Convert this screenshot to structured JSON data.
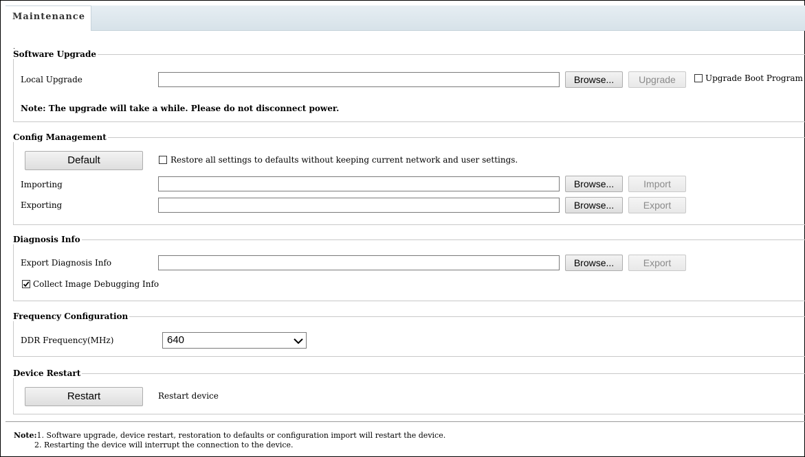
{
  "tab": {
    "label": "Maintenance"
  },
  "software_upgrade": {
    "legend": "Software Upgrade",
    "local_upgrade_label": "Local Upgrade",
    "local_upgrade_value": "",
    "browse_label": "Browse...",
    "upgrade_label": "Upgrade",
    "boot_program_label": "Upgrade Boot Program",
    "boot_program_checked": false,
    "note": "Note: The upgrade will take a while. Please do not disconnect power."
  },
  "config_management": {
    "legend": "Config Management",
    "default_label": "Default",
    "restore_label": "Restore all settings to defaults without keeping current network and user settings.",
    "restore_checked": false,
    "importing_label": "Importing",
    "importing_value": "",
    "import_browse_label": "Browse...",
    "import_label": "Import",
    "exporting_label": "Exporting",
    "exporting_value": "",
    "export_browse_label": "Browse...",
    "export_label": "Export"
  },
  "diagnosis_info": {
    "legend": "Diagnosis Info",
    "export_diag_label": "Export Diagnosis Info",
    "export_diag_value": "",
    "browse_label": "Browse...",
    "export_label": "Export",
    "collect_label": "Collect Image Debugging Info",
    "collect_checked": true
  },
  "frequency_configuration": {
    "legend": "Frequency Configuration",
    "ddr_label": "DDR Frequency(MHz)",
    "ddr_value": "640"
  },
  "device_restart": {
    "legend": "Device Restart",
    "restart_label": "Restart",
    "restart_desc": "Restart device"
  },
  "notes": {
    "prefix": "Note:",
    "line1": "1. Software upgrade, device restart, restoration to defaults or configuration import will restart the device.",
    "line2": "2. Restarting the device will interrupt the connection to the device."
  }
}
